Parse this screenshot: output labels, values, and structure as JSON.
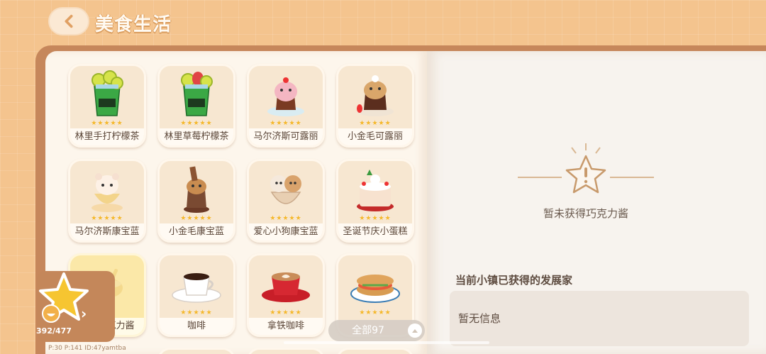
{
  "header": {
    "title": "美食生活"
  },
  "items": [
    {
      "name": "林里手打柠檬茶",
      "stars": "★★★★★"
    },
    {
      "name": "林里草莓柠檬茶",
      "stars": "★★★★★"
    },
    {
      "name": "马尔济斯可露丽",
      "stars": "★★★★★"
    },
    {
      "name": "小金毛可露丽",
      "stars": "★★★★★"
    },
    {
      "name": "马尔济斯康宝蓝",
      "stars": "★★★★★"
    },
    {
      "name": "小金毛康宝蓝",
      "stars": "★★★★★"
    },
    {
      "name": "爱心小狗康宝蓝",
      "stars": "★★★★★"
    },
    {
      "name": "圣诞节庆小蛋糕",
      "stars": "★★★★★"
    },
    {
      "name": "克力酱",
      "stars": ""
    },
    {
      "name": "咖啡",
      "stars": "★★★★★"
    },
    {
      "name": "拿铁咖啡",
      "stars": "★★★★★"
    },
    {
      "name": "",
      "stars": "★★★★★"
    }
  ],
  "detail": {
    "empty_text": "暂未获得巧克力酱",
    "section_title": "当前小镇已获得的发展家",
    "info_text": "暂无信息"
  },
  "filter": {
    "label": "全部97"
  },
  "collection": {
    "count": "392/477"
  },
  "debug": "P:30  P:141  ID:47yamtba",
  "colors": {
    "background": "#f4c48e",
    "star": "#f5b82b",
    "book": "#c6875b"
  }
}
